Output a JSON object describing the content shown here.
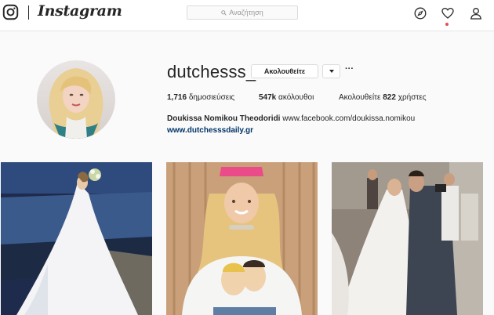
{
  "nav": {
    "logo_icon": "instagram-camera-icon",
    "wordmark": "Instagram",
    "search_placeholder": "Αναζήτηση",
    "icons": [
      "compass-icon",
      "heart-icon",
      "person-icon"
    ]
  },
  "profile": {
    "username": "dutchesss_",
    "follow_label": "Ακολουθείτε",
    "stats": {
      "posts_count": "1,716",
      "posts_label": "δημοσιεύσεις",
      "followers_count": "547k",
      "followers_label": "ακόλουθοι",
      "following_prefix": "Ακολουθείτε",
      "following_count": "822",
      "following_label": "χρήστες"
    },
    "bio_name": "Doukissa Nomikou Theodoridi",
    "bio_link": "www.facebook.com/doukissa.nomikou",
    "website": "www.dutchesssdaily.gr"
  },
  "colors": {
    "link": "#003569",
    "notification": "#ed4956",
    "border": "#dbdbdb"
  },
  "posts": [
    {
      "alt": "bride-on-cliff"
    },
    {
      "alt": "woman-pink-cap-tshirt"
    },
    {
      "alt": "wedding-kiss"
    }
  ]
}
